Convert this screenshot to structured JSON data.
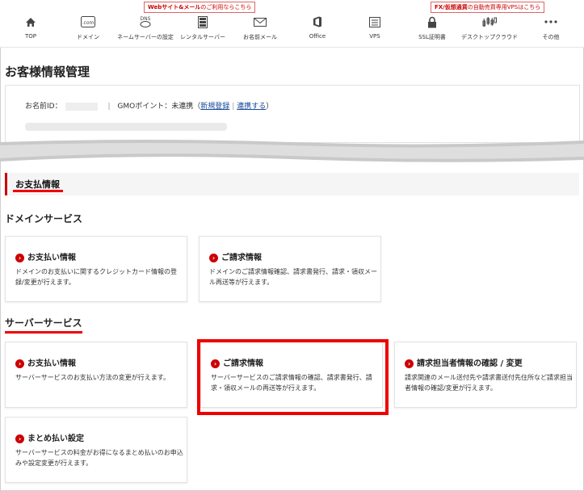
{
  "nav": {
    "items": [
      {
        "label": "TOP",
        "icon": "home-icon"
      },
      {
        "label": "ドメイン",
        "icon": "com-icon"
      },
      {
        "label": "ネームサーバーの設定",
        "icon": "dns-icon"
      },
      {
        "label": "レンタルサーバー",
        "icon": "server-icon"
      },
      {
        "label": "お名前メール",
        "icon": "mail-icon"
      },
      {
        "label": "Office",
        "icon": "office-icon"
      },
      {
        "label": "VPS",
        "icon": "vps-icon"
      },
      {
        "label": "SSL証明書",
        "icon": "lock-icon"
      },
      {
        "label": "デスクトップクラウド",
        "icon": "chart-icon"
      },
      {
        "label": "その他",
        "icon": "more-icon"
      }
    ],
    "callout_left": {
      "bold": "Webサイト&メール",
      "rest": "のご利用ならこちら"
    },
    "callout_right": {
      "bold": "FX/仮想通貨",
      "rest": "の自動売買専用VPSはこちら"
    }
  },
  "page_title": "お客様情報管理",
  "account": {
    "id_label": "お名前ID：",
    "separator": "|",
    "gmo_label": "GMOポイント：未連携（",
    "register_link": "新規登録",
    "link_separator": "|",
    "connect_link": "連携する",
    "close_paren": "）"
  },
  "payment_section": {
    "title": "お支払情報"
  },
  "domain_service": {
    "title": "ドメインサービス",
    "cards": [
      {
        "title": "お支払い情報",
        "desc": "ドメインのお支払いに関するクレジットカード情報の登録/変更が行えます。"
      },
      {
        "title": "ご請求情報",
        "desc": "ドメインのご請求情報確認、請求書発行、請求・領収メール再送等が行えます。"
      }
    ]
  },
  "server_service": {
    "title": "サーバーサービス",
    "cards": [
      {
        "title": "お支払い情報",
        "desc": "サーバーサービスのお支払い方法の変更が行えます。"
      },
      {
        "title": "ご請求情報",
        "desc": "サーバーサービスのご請求情報の確認、請求書発行、請求・領収メールの再送等が行えます。"
      },
      {
        "title": "請求担当者情報の確認 / 変更",
        "desc": "請求関連のメール送付先や請求書送付先住所など請求担当者情報の確認/変更が行えます。"
      },
      {
        "title": "まとめ払い設定",
        "desc": "サーバーサービスの料金がお得になるまとめ払いのお申込みや設定変更が行えます。"
      }
    ]
  },
  "colors": {
    "accent": "#cc0000",
    "highlight": "#ee0000"
  }
}
